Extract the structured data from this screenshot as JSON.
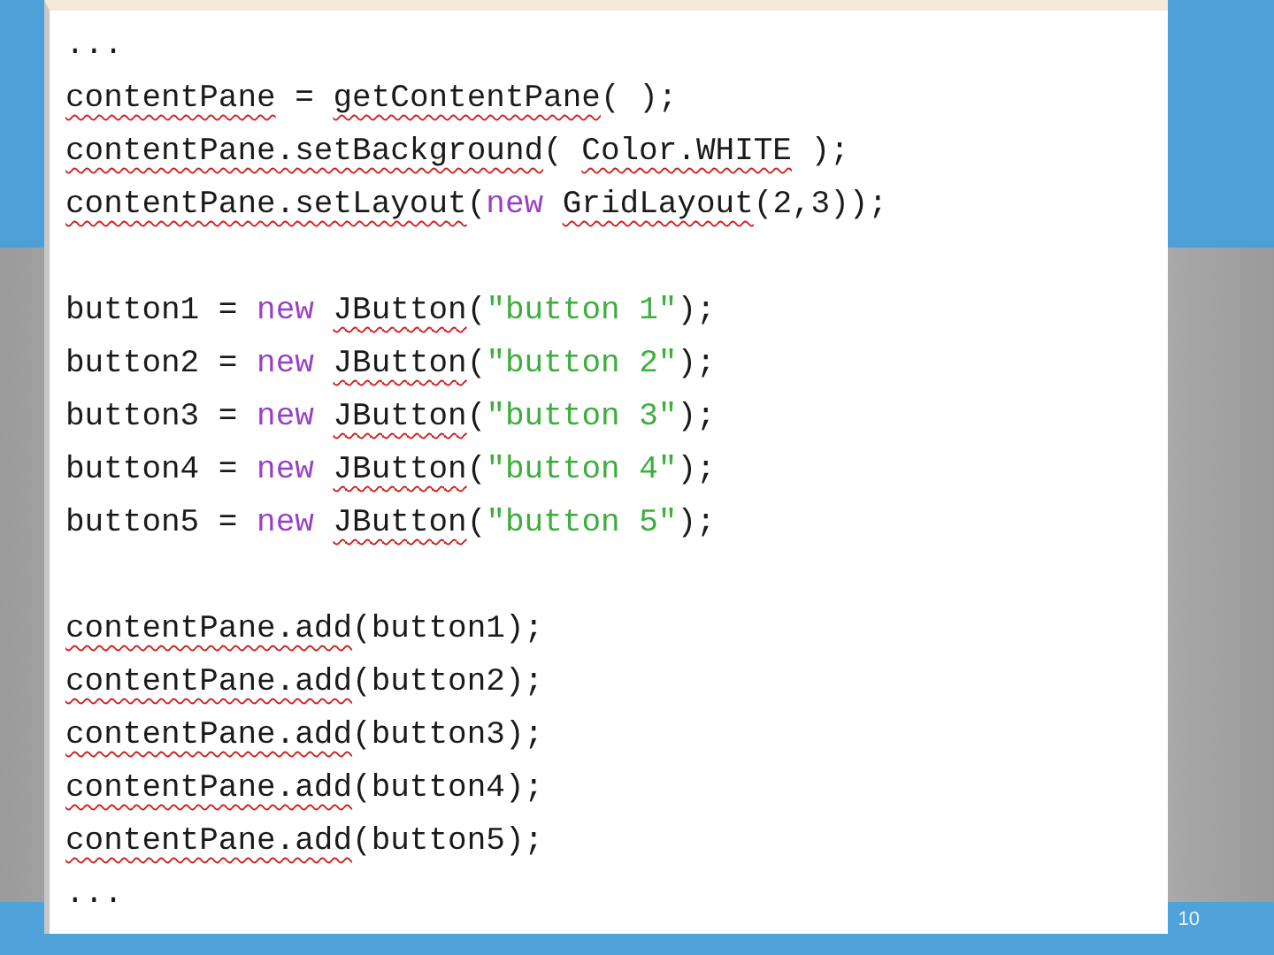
{
  "code_lines": [
    {
      "kind": "code",
      "tokens": [
        {
          "kind": "plain",
          "text": "..."
        }
      ]
    },
    {
      "kind": "code",
      "tokens": [
        {
          "kind": "flagged",
          "text": "contentPane"
        },
        {
          "kind": "plain",
          "text": " = "
        },
        {
          "kind": "flagged",
          "text": "getContentPane"
        },
        {
          "kind": "plain",
          "text": "( );"
        }
      ]
    },
    {
      "kind": "code",
      "tokens": [
        {
          "kind": "flagged",
          "text": "contentPane.setBackground"
        },
        {
          "kind": "plain",
          "text": "( "
        },
        {
          "kind": "flagged",
          "text": "Color.WHITE"
        },
        {
          "kind": "plain",
          "text": " );"
        }
      ]
    },
    {
      "kind": "code",
      "tokens": [
        {
          "kind": "flagged",
          "text": "contentPane.setLayout"
        },
        {
          "kind": "plain",
          "text": "("
        },
        {
          "kind": "keyword",
          "text": "new "
        },
        {
          "kind": "flagged",
          "text": "GridLayout"
        },
        {
          "kind": "plain",
          "text": "(2,3));"
        }
      ]
    },
    {
      "kind": "blank"
    },
    {
      "kind": "code",
      "tokens": [
        {
          "kind": "plain",
          "text": "button1 = "
        },
        {
          "kind": "keyword",
          "text": "new "
        },
        {
          "kind": "flagged",
          "text": "JButton"
        },
        {
          "kind": "plain",
          "text": "("
        },
        {
          "kind": "string",
          "text": "\"button 1\""
        },
        {
          "kind": "plain",
          "text": ");"
        }
      ]
    },
    {
      "kind": "code",
      "tokens": [
        {
          "kind": "plain",
          "text": "button2 = "
        },
        {
          "kind": "keyword",
          "text": "new "
        },
        {
          "kind": "flagged",
          "text": "JButton"
        },
        {
          "kind": "plain",
          "text": "("
        },
        {
          "kind": "string",
          "text": "\"button 2\""
        },
        {
          "kind": "plain",
          "text": ");"
        }
      ]
    },
    {
      "kind": "code",
      "tokens": [
        {
          "kind": "plain",
          "text": "button3 = "
        },
        {
          "kind": "keyword",
          "text": "new "
        },
        {
          "kind": "flagged",
          "text": "JButton"
        },
        {
          "kind": "plain",
          "text": "("
        },
        {
          "kind": "string",
          "text": "\"button 3\""
        },
        {
          "kind": "plain",
          "text": ");"
        }
      ]
    },
    {
      "kind": "code",
      "tokens": [
        {
          "kind": "plain",
          "text": "button4 = "
        },
        {
          "kind": "keyword",
          "text": "new "
        },
        {
          "kind": "flagged",
          "text": "JButton"
        },
        {
          "kind": "plain",
          "text": "("
        },
        {
          "kind": "string",
          "text": "\"button 4\""
        },
        {
          "kind": "plain",
          "text": ");"
        }
      ]
    },
    {
      "kind": "code",
      "tokens": [
        {
          "kind": "plain",
          "text": "button5 = "
        },
        {
          "kind": "keyword",
          "text": "new "
        },
        {
          "kind": "flagged",
          "text": "JButton"
        },
        {
          "kind": "plain",
          "text": "("
        },
        {
          "kind": "string",
          "text": "\"button 5\""
        },
        {
          "kind": "plain",
          "text": ");"
        }
      ]
    },
    {
      "kind": "blank"
    },
    {
      "kind": "code",
      "tokens": [
        {
          "kind": "flagged",
          "text": "contentPane.add"
        },
        {
          "kind": "plain",
          "text": "(button1);"
        }
      ]
    },
    {
      "kind": "code",
      "tokens": [
        {
          "kind": "flagged",
          "text": "contentPane.add"
        },
        {
          "kind": "plain",
          "text": "(button2);"
        }
      ]
    },
    {
      "kind": "code",
      "tokens": [
        {
          "kind": "flagged",
          "text": "contentPane.add"
        },
        {
          "kind": "plain",
          "text": "(button3);"
        }
      ]
    },
    {
      "kind": "code",
      "tokens": [
        {
          "kind": "flagged",
          "text": "contentPane.add"
        },
        {
          "kind": "plain",
          "text": "(button4);"
        }
      ]
    },
    {
      "kind": "code",
      "tokens": [
        {
          "kind": "flagged",
          "text": "contentPane.add"
        },
        {
          "kind": "plain",
          "text": "(button5);"
        }
      ]
    },
    {
      "kind": "code",
      "tokens": [
        {
          "kind": "plain",
          "text": "..."
        }
      ]
    }
  ],
  "slide_number": "10"
}
